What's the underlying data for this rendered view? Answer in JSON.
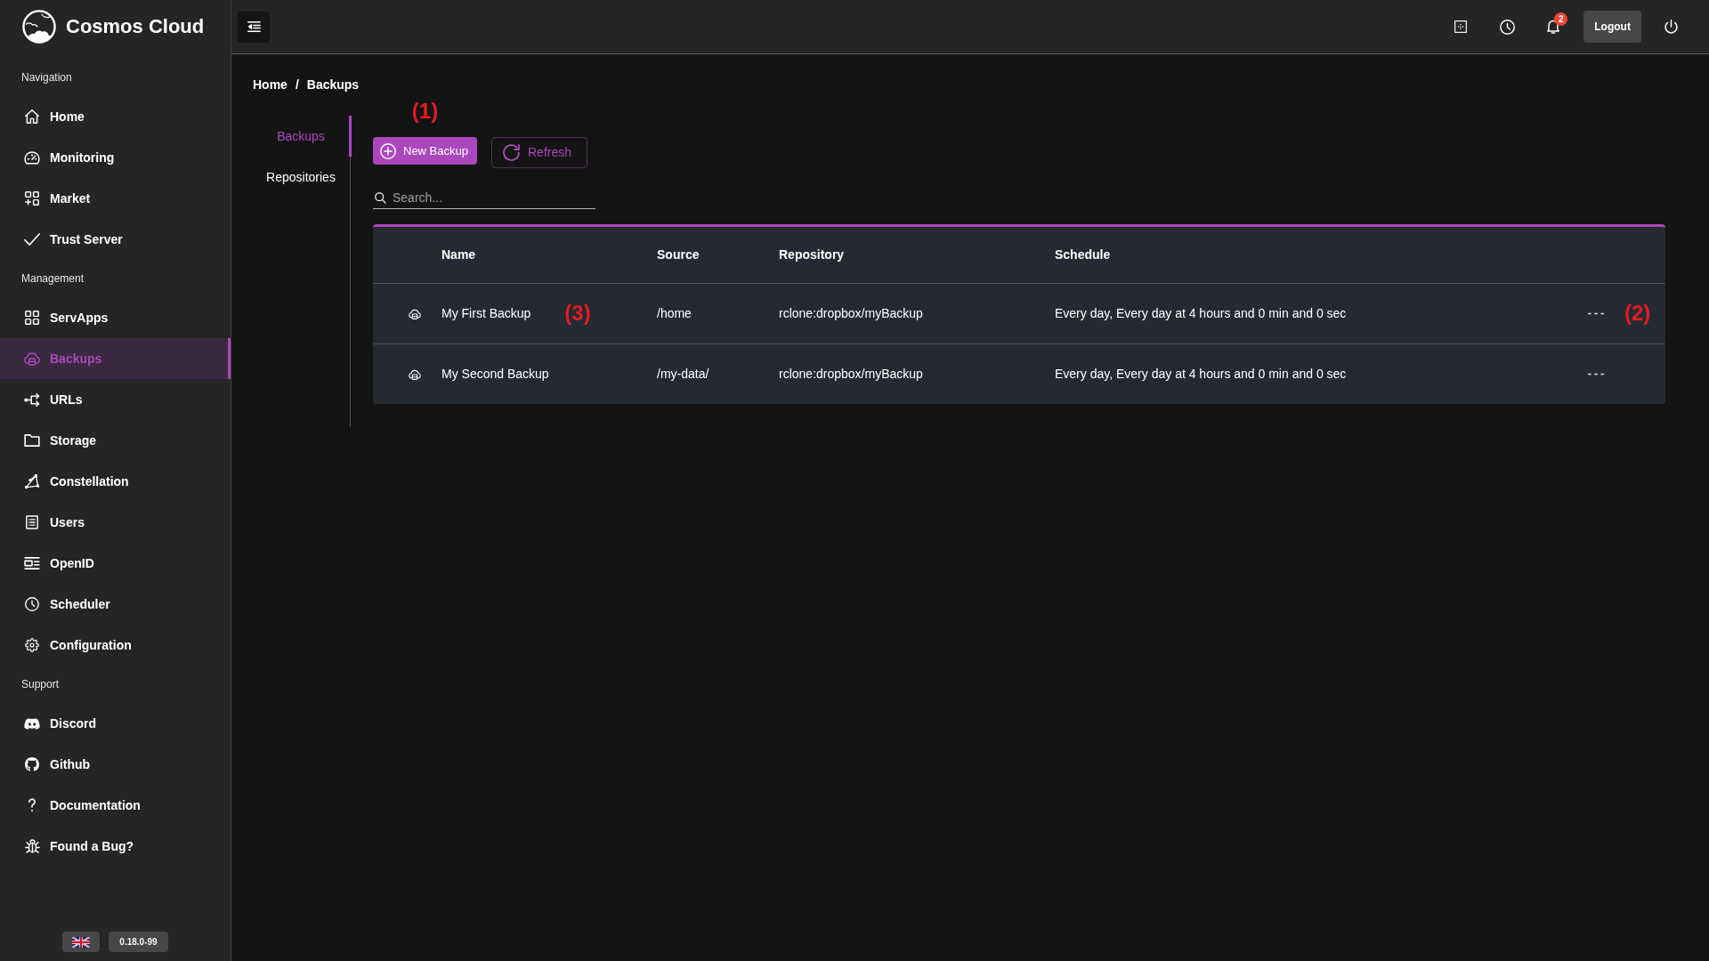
{
  "sidebar": {
    "brand": "Cosmos Cloud",
    "sections": [
      {
        "title": "Navigation",
        "items": [
          {
            "label": "Home",
            "kind": "home",
            "selected": false
          },
          {
            "label": "Monitoring",
            "kind": "gauge",
            "selected": false
          },
          {
            "label": "Market",
            "kind": "market",
            "selected": false
          },
          {
            "label": "Trust Server",
            "kind": "check",
            "selected": false
          }
        ]
      },
      {
        "title": "Management",
        "items": [
          {
            "label": "ServApps",
            "kind": "apps",
            "selected": false
          },
          {
            "label": "Backups",
            "kind": "backup",
            "selected": true
          },
          {
            "label": "URLs",
            "kind": "urls",
            "selected": false
          },
          {
            "label": "Storage",
            "kind": "folder",
            "selected": false
          },
          {
            "label": "Constellation",
            "kind": "constellation",
            "selected": false
          },
          {
            "label": "Users",
            "kind": "users",
            "selected": false
          },
          {
            "label": "OpenID",
            "kind": "openid",
            "selected": false
          },
          {
            "label": "Scheduler",
            "kind": "clock",
            "selected": false
          },
          {
            "label": "Configuration",
            "kind": "gear",
            "selected": false
          }
        ]
      },
      {
        "title": "Support",
        "items": [
          {
            "label": "Discord",
            "kind": "discord",
            "selected": false
          },
          {
            "label": "Github",
            "kind": "github",
            "selected": false
          },
          {
            "label": "Documentation",
            "kind": "question",
            "selected": false
          },
          {
            "label": "Found a Bug?",
            "kind": "bug",
            "selected": false
          }
        ]
      }
    ],
    "version": "0.18.0-99"
  },
  "topbar": {
    "notification_count": "2",
    "logout": "Logout"
  },
  "breadcrumb": {
    "items": [
      "Home",
      "Backups"
    ],
    "separator": "/"
  },
  "tabs": [
    {
      "label": "Backups",
      "selected": true
    },
    {
      "label": "Repositories",
      "selected": false
    }
  ],
  "toolbar": {
    "callout": "(1)",
    "buttons": [
      {
        "label": "New Backup",
        "kind": "add"
      },
      {
        "label": "Refresh",
        "kind": "refresh"
      }
    ]
  },
  "search": {
    "placeholder": "Search..."
  },
  "table": {
    "columns": [
      "Name",
      "Source",
      "Repository",
      "Schedule"
    ],
    "rows": [
      {
        "name": "My First Backup",
        "name_callout": "(3)",
        "source": "/home",
        "repository": "rclone:dropbox/myBackup",
        "schedule": "Every day, Every day at 4 hours and 0 min and 0 sec",
        "menu_callout": "(2)"
      },
      {
        "name": "My Second Backup",
        "source": "/my-data/",
        "repository": "rclone:dropbox/myBackup",
        "schedule": "Every day, Every day at 4 hours and 0 min and 0 sec"
      }
    ]
  }
}
